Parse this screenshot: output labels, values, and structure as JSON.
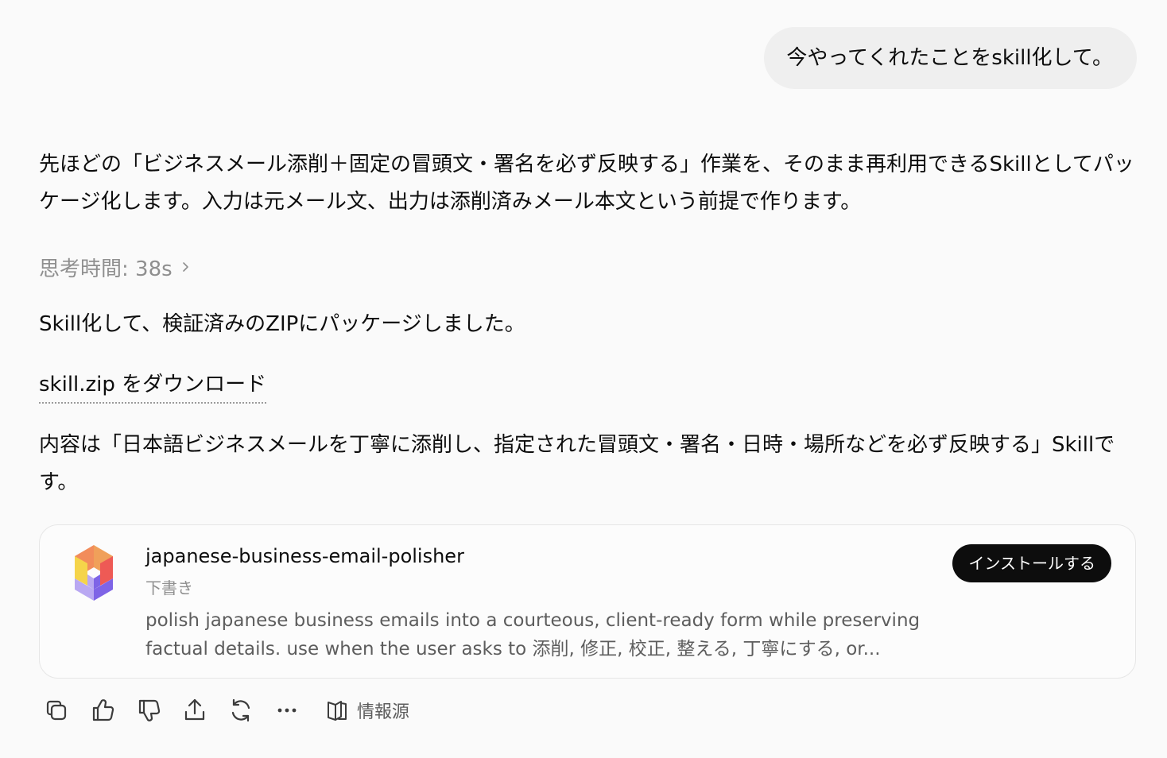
{
  "user_message": "今やってくれたことをskill化して。",
  "assistant": {
    "intro": "先ほどの「ビジネスメール添削＋固定の冒頭文・署名を必ず反映する」作業を、そのまま再利用できるSkillとしてパッケージ化します。入力は元メール文、出力は添削済みメール本文という前提で作ります。",
    "thinking_label": "思考時間: 38s",
    "packaged": "Skill化して、検証済みのZIPにパッケージしました。",
    "download_link": "skill.zip をダウンロード",
    "contents": "内容は「日本語ビジネスメールを丁寧に添削し、指定された冒頭文・署名・日時・場所などを必ず反映する」Skillです。"
  },
  "skill_card": {
    "name": "japanese-business-email-polisher",
    "status": "下書き",
    "description": "polish japanese business emails into a courteous, client-ready form while preserving factual details. use when the user asks to 添削, 修正, 校正, 整える, 丁寧にする, or...",
    "install_label": "インストールする",
    "logo_colors": {
      "top_left": "#f28c5b",
      "top_right": "#f0a05a",
      "left_yellow": "#f5d44a",
      "right_red": "#ee5a55",
      "bottom_left": "#b9a8f2",
      "bottom_right": "#7e64e6"
    }
  },
  "actions": {
    "icons": [
      "copy-icon",
      "thumbs-up-icon",
      "thumbs-down-icon",
      "share-icon",
      "regenerate-icon",
      "more-icon"
    ],
    "sources_label": "情報源"
  }
}
